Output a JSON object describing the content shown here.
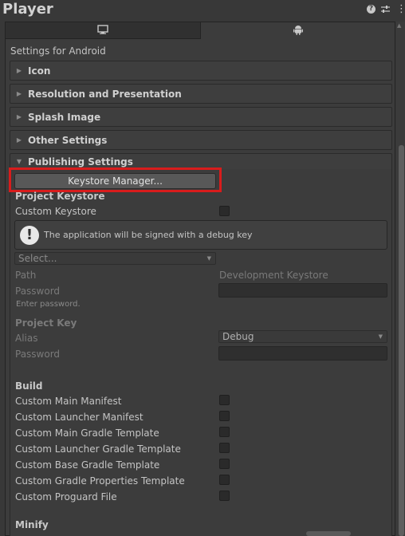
{
  "header": {
    "title": "Player",
    "icons": [
      "help-icon",
      "sliders-icon",
      "kebab-menu-icon"
    ]
  },
  "tabs": [
    {
      "icon": "monitor-icon",
      "selected": false
    },
    {
      "icon": "android-icon",
      "selected": true
    }
  ],
  "platform_label": "Settings for Android",
  "sections": {
    "icon": "Icon",
    "resolution": "Resolution and Presentation",
    "splash": "Splash Image",
    "other": "Other Settings",
    "publishing": "Publishing Settings"
  },
  "publishing": {
    "keystore_manager_button": "Keystore Manager...",
    "project_keystore_heading": "Project Keystore",
    "custom_keystore_label": "Custom Keystore",
    "custom_keystore_checked": false,
    "helpbox_message": "The application will be signed with a debug key",
    "select_placeholder": "Select...",
    "path_label": "Path",
    "path_value": "Development Keystore",
    "password_label": "Password",
    "password_hint": "Enter password.",
    "project_key_heading": "Project Key",
    "alias_label": "Alias",
    "alias_value": "Debug",
    "key_password_label": "Password",
    "build_heading": "Build",
    "build_options": [
      {
        "label": "Custom Main Manifest",
        "checked": false
      },
      {
        "label": "Custom Launcher Manifest",
        "checked": false
      },
      {
        "label": "Custom Main Gradle Template",
        "checked": false
      },
      {
        "label": "Custom Launcher Gradle Template",
        "checked": false
      },
      {
        "label": "Custom Base Gradle Template",
        "checked": false
      },
      {
        "label": "Custom Gradle Properties Template",
        "checked": false
      },
      {
        "label": "Custom Proguard File",
        "checked": false
      }
    ],
    "minify_heading": "Minify"
  },
  "colors": {
    "background": "#383838",
    "highlight": "#d81c1c",
    "button": "#585858"
  }
}
